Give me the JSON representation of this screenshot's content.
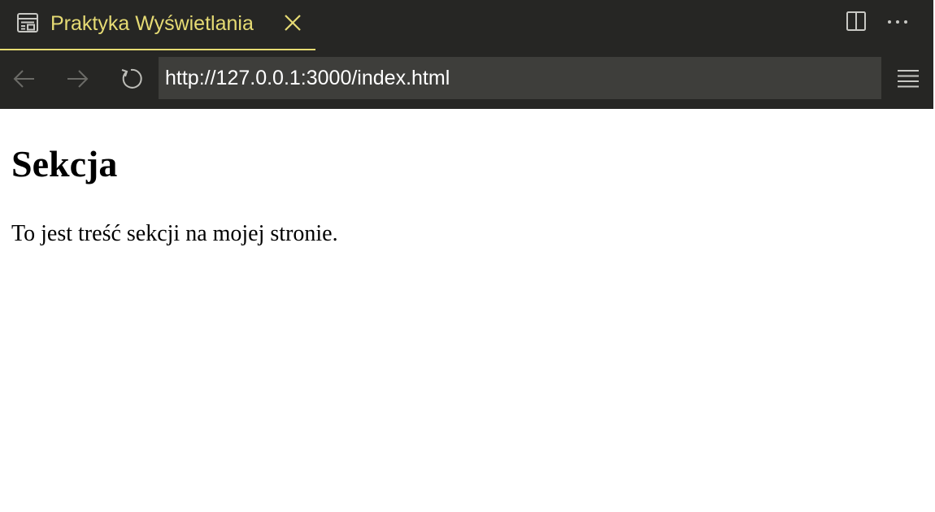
{
  "tab": {
    "title": "Praktyka Wyświetlania",
    "icon": "preview-icon",
    "accent_color": "#e6db74"
  },
  "toolbar": {
    "close_icon": "close-icon",
    "split_icon": "split-editor-icon",
    "more_icon": "more-actions-icon"
  },
  "nav": {
    "back_icon": "arrow-left-icon",
    "forward_icon": "arrow-right-icon",
    "reload_icon": "reload-icon",
    "url": "http://127.0.0.1:3000/index.html",
    "menu_icon": "hamburger-menu-icon"
  },
  "page": {
    "heading": "Sekcja",
    "paragraph": "To jest treść sekcji na mojej stronie."
  }
}
